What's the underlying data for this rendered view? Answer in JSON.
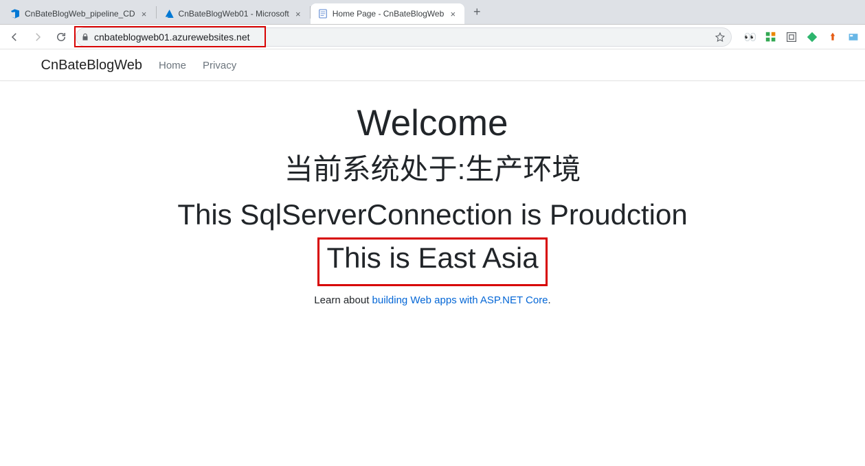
{
  "browser": {
    "tabs": [
      {
        "title": "CnBateBlogWeb_pipeline_CD",
        "favicon": "azure-devops",
        "active": false
      },
      {
        "title": "CnBateBlogWeb01 - Microsoft",
        "favicon": "azure",
        "active": false
      },
      {
        "title": "Home Page - CnBateBlogWeb",
        "favicon": "doc",
        "active": true
      }
    ],
    "url": "cnbateblogweb01.azurewebsites.net"
  },
  "site": {
    "brand": "CnBateBlogWeb",
    "nav": {
      "home": "Home",
      "privacy": "Privacy"
    }
  },
  "hero": {
    "welcome": "Welcome",
    "env": "当前系统处于:生产环境",
    "sql": "This SqlServerConnection is Proudction",
    "region": "This is East Asia",
    "learn_prefix": "Learn about ",
    "learn_link": "building Web apps with ASP.NET Core",
    "learn_suffix": "."
  }
}
